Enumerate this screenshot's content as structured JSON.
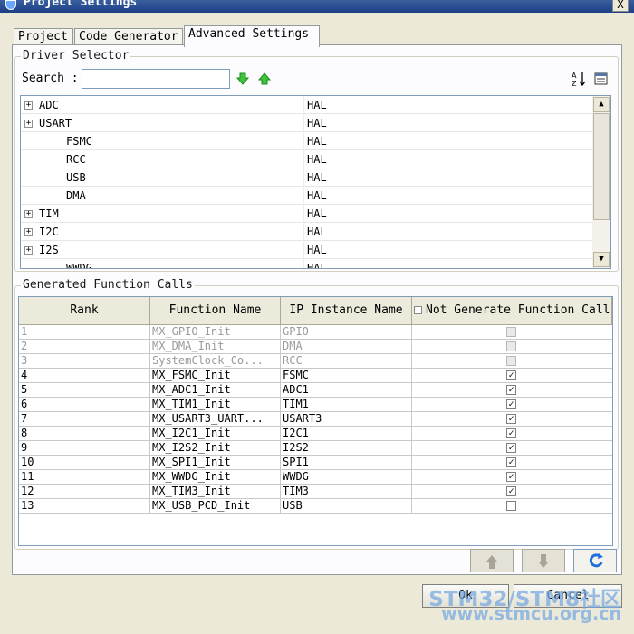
{
  "window": {
    "title": "Project Settings",
    "close": "X"
  },
  "tabs": [
    "Project",
    "Code Generator",
    "Advanced Settings"
  ],
  "driver_selector": {
    "title": "Driver Selector",
    "search_label": "Search :",
    "search_value": "",
    "rows": [
      {
        "name": "ADC",
        "value": "HAL",
        "expandable": true,
        "expander": "+"
      },
      {
        "name": "USART",
        "value": "HAL",
        "expandable": true,
        "expander": "+"
      },
      {
        "name": "FSMC",
        "value": "HAL",
        "expandable": false
      },
      {
        "name": "RCC",
        "value": "HAL",
        "expandable": false
      },
      {
        "name": "USB",
        "value": "HAL",
        "expandable": false
      },
      {
        "name": "DMA",
        "value": "HAL",
        "expandable": false
      },
      {
        "name": "TIM",
        "value": "HAL",
        "expandable": true,
        "expander": "+"
      },
      {
        "name": "I2C",
        "value": "HAL",
        "expandable": true,
        "expander": "+"
      },
      {
        "name": "I2S",
        "value": "HAL",
        "expandable": true,
        "expander": "+"
      },
      {
        "name": "WWDG",
        "value": "HAL",
        "expandable": false
      }
    ],
    "icons": [
      "green-down-arrow-icon",
      "green-up-arrow-icon",
      "sort-az-icon",
      "list-view-icon"
    ]
  },
  "generated_calls": {
    "title": "Generated Function Calls",
    "headers": {
      "rank": "Rank",
      "function": "Function Name",
      "ip": "IP Instance Name",
      "not_generate": "Not Generate Function Call"
    },
    "rows": [
      {
        "rank": "1",
        "function": "MX_GPIO_Init",
        "ip": "GPIO",
        "checked": false,
        "disabled": true
      },
      {
        "rank": "2",
        "function": "MX_DMA_Init",
        "ip": "DMA",
        "checked": false,
        "disabled": true
      },
      {
        "rank": "3",
        "function": "SystemClock_Co...",
        "ip": "RCC",
        "checked": false,
        "disabled": true
      },
      {
        "rank": "4",
        "function": "MX_FSMC_Init",
        "ip": "FSMC",
        "checked": true,
        "disabled": false
      },
      {
        "rank": "5",
        "function": "MX_ADC1_Init",
        "ip": "ADC1",
        "checked": true,
        "disabled": false
      },
      {
        "rank": "6",
        "function": "MX_TIM1_Init",
        "ip": "TIM1",
        "checked": true,
        "disabled": false
      },
      {
        "rank": "7",
        "function": "MX_USART3_UART...",
        "ip": "USART3",
        "checked": true,
        "disabled": false
      },
      {
        "rank": "8",
        "function": "MX_I2C1_Init",
        "ip": "I2C1",
        "checked": true,
        "disabled": false
      },
      {
        "rank": "9",
        "function": "MX_I2S2_Init",
        "ip": "I2S2",
        "checked": true,
        "disabled": false
      },
      {
        "rank": "10",
        "function": "MX_SPI1_Init",
        "ip": "SPI1",
        "checked": true,
        "disabled": false
      },
      {
        "rank": "11",
        "function": "MX_WWDG_Init",
        "ip": "WWDG",
        "checked": true,
        "disabled": false
      },
      {
        "rank": "12",
        "function": "MX_TIM3_Init",
        "ip": "TIM3",
        "checked": true,
        "disabled": false
      },
      {
        "rank": "13",
        "function": "MX_USB_PCD_Init",
        "ip": "USB",
        "checked": false,
        "disabled": false
      }
    ],
    "check_mark": "✓"
  },
  "buttons": {
    "ok": "Ok",
    "cancel": "Cancel"
  },
  "watermark": {
    "line1": "STM32/STM8社区",
    "line2": "www.stmcu.org.cn"
  },
  "colors": {
    "title_bar": "#1c3f86",
    "green_arrow": "#3bc43b",
    "refresh_blue": "#1e6fd9",
    "watermark": "#78aae1"
  }
}
